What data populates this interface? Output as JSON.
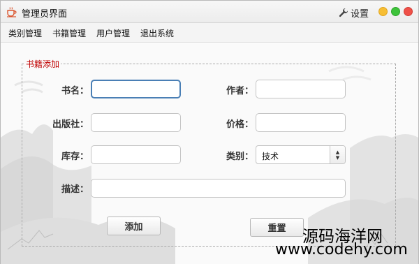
{
  "window": {
    "title": "管理员界面",
    "settings_label": "设置"
  },
  "menu": {
    "items": [
      {
        "label": "类别管理"
      },
      {
        "label": "书籍管理"
      },
      {
        "label": "用户管理"
      },
      {
        "label": "退出系统"
      }
    ]
  },
  "form": {
    "legend": "书籍添加",
    "name_label": "书名：",
    "name_value": "",
    "author_label": "作者：",
    "author_value": "",
    "publisher_label": "出版社：",
    "publisher_value": "",
    "price_label": "价格：",
    "price_value": "",
    "stock_label": "库存：",
    "stock_value": "",
    "category_label": "类别：",
    "category_value": "技术",
    "description_label": "描述：",
    "description_value": "",
    "add_button": "添加",
    "reset_button": "重置"
  },
  "watermark": {
    "line1": "源码海洋网",
    "line2": "www.codehy.com"
  },
  "colors": {
    "legend": "#c00000",
    "focus_border": "#4a7fb5",
    "min_dot": "#f7be34",
    "max_dot": "#3ec33b",
    "close_dot": "#ef5048"
  }
}
